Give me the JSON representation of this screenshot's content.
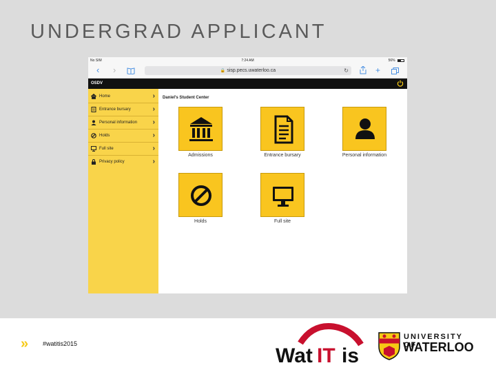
{
  "slide": {
    "title": "UNDERGRAD APPLICANT",
    "hashtag": "#watitis2015"
  },
  "status_bar": {
    "carrier": "No SIM",
    "time": "7:24 AM",
    "battery": "56%",
    "battery_level": 0.56
  },
  "browser": {
    "url": "sisp.pecs.uwaterloo.ca",
    "back_icon": "chevron-left-icon",
    "forward_icon": "chevron-right-icon",
    "bookmarks_icon": "book-icon",
    "share_icon": "share-icon",
    "new_tab_icon": "plus-icon",
    "tabs_icon": "tabs-icon"
  },
  "app": {
    "name": "OSDV",
    "power_icon": "power-icon"
  },
  "sidebar": {
    "items": [
      {
        "label": "Home",
        "icon": "home-icon"
      },
      {
        "label": "Entrance bursary",
        "icon": "document-icon"
      },
      {
        "label": "Personal information",
        "icon": "person-icon"
      },
      {
        "label": "Holds",
        "icon": "no-entry-icon"
      },
      {
        "label": "Full site",
        "icon": "monitor-icon"
      },
      {
        "label": "Privacy policy",
        "icon": "lock-icon"
      }
    ]
  },
  "main": {
    "title": "Daniel's Student Center",
    "tiles": [
      {
        "label": "Admissions",
        "icon": "building-icon"
      },
      {
        "label": "Entrance bursary",
        "icon": "document-icon"
      },
      {
        "label": "Personal information",
        "icon": "person-icon"
      },
      {
        "label": "Holds",
        "icon": "no-entry-icon"
      },
      {
        "label": "Full site",
        "icon": "monitor-icon"
      }
    ]
  },
  "logos": {
    "watitis": "WatITis",
    "uw_line1": "UNIVERSITY OF",
    "uw_line2": "WATERLOO"
  },
  "colors": {
    "accent_yellow": "#f9c51f",
    "sidebar_yellow": "#f9d44a",
    "header_black": "#111111",
    "watitis_red": "#c8102e"
  }
}
